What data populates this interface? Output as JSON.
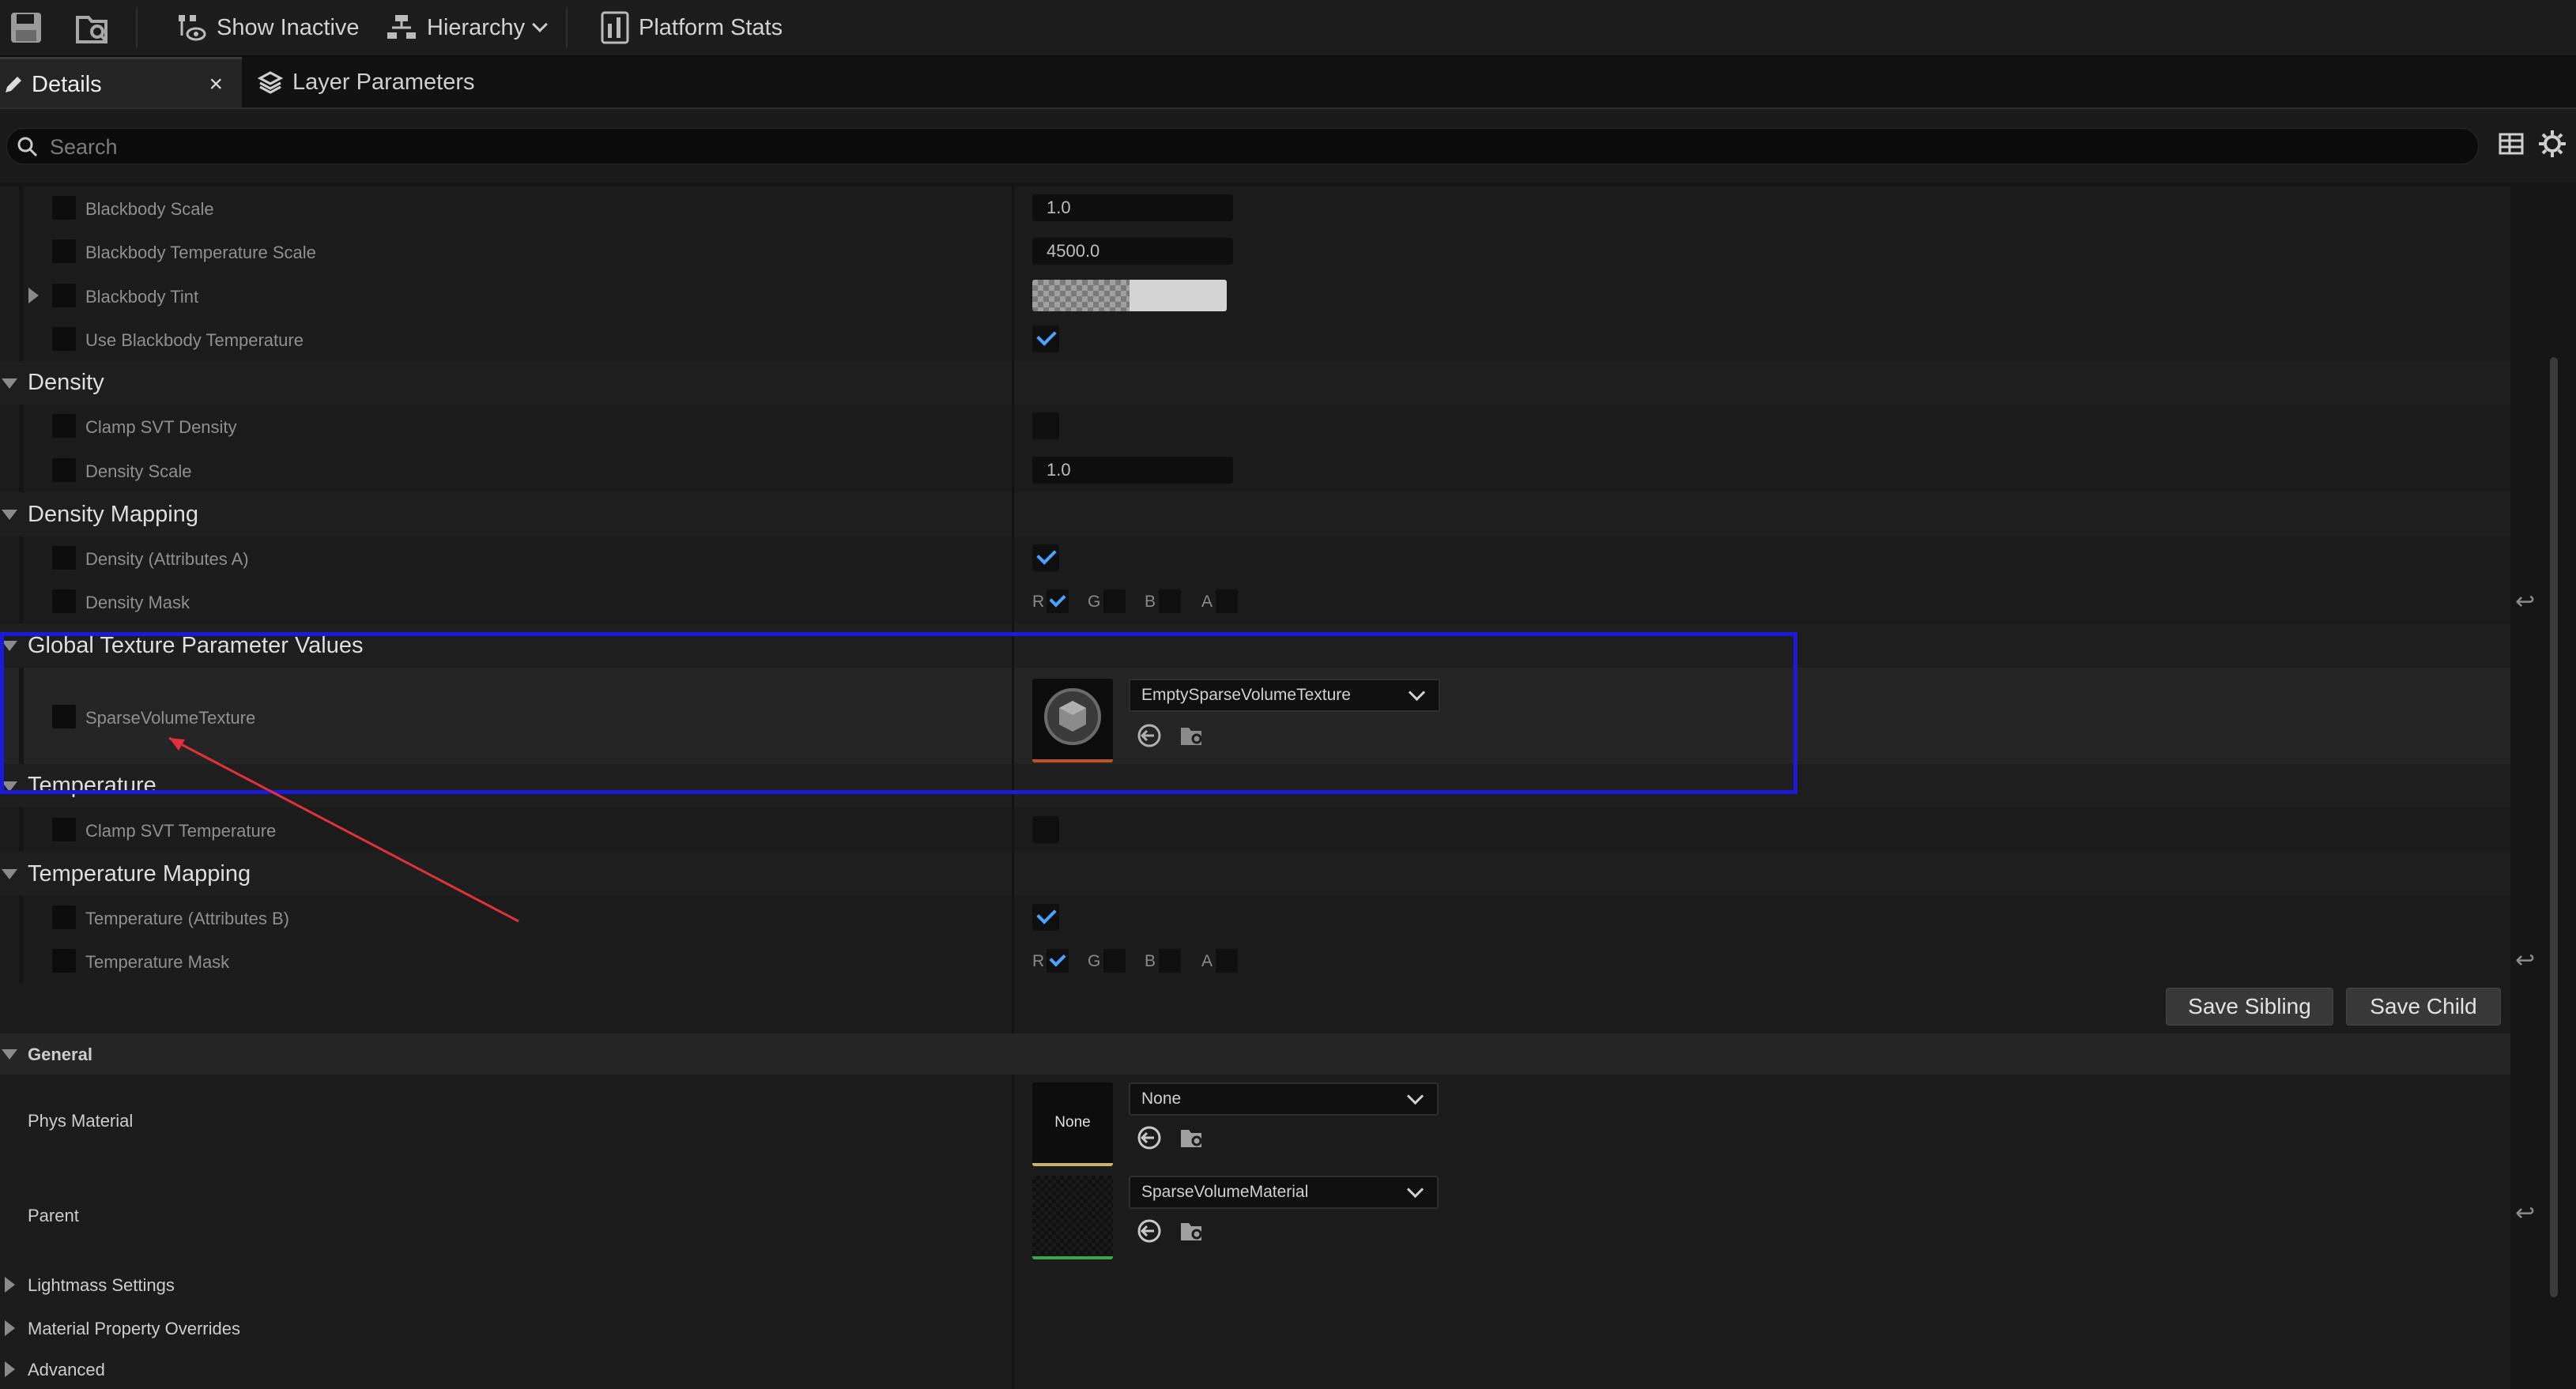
{
  "toolbar": {
    "save_icon": "save-icon",
    "browse_icon": "browse-icon",
    "show_inactive": "Show Inactive",
    "hierarchy": "Hierarchy",
    "platform_stats": "Platform Stats"
  },
  "tabs": {
    "details": "Details",
    "details_close": "×",
    "layer_parameters": "Layer Parameters"
  },
  "search": {
    "placeholder": "Search"
  },
  "blackbody": {
    "scale_label": "Blackbody Scale",
    "scale_value": "1.0",
    "temp_scale_label": "Blackbody Temperature Scale",
    "temp_scale_value": "4500.0",
    "tint_label": "Blackbody Tint",
    "use_temp_label": "Use Blackbody Temperature",
    "use_temp_checked": true
  },
  "density": {
    "title": "Density",
    "clamp_label": "Clamp SVT Density",
    "clamp_checked": false,
    "scale_label": "Density Scale",
    "scale_value": "1.0"
  },
  "density_mapping": {
    "title": "Density Mapping",
    "attr_label": "Density (Attributes A)",
    "attr_checked": true,
    "mask_label": "Density Mask",
    "channels": [
      "R",
      "G",
      "B",
      "A"
    ]
  },
  "global_texture": {
    "title": "Global Texture Parameter Values",
    "svt_label": "SparseVolumeTexture",
    "svt_value": "EmptySparseVolumeTexture"
  },
  "temperature": {
    "title": "Temperature",
    "clamp_label": "Clamp SVT Temperature",
    "clamp_checked": false
  },
  "temperature_mapping": {
    "title": "Temperature Mapping",
    "attr_label": "Temperature (Attributes B)",
    "attr_checked": true,
    "mask_label": "Temperature Mask",
    "channels": [
      "R",
      "G",
      "B",
      "A"
    ]
  },
  "actions": {
    "save_sibling": "Save Sibling",
    "save_child": "Save Child"
  },
  "general": {
    "title": "General",
    "phys_label": "Phys Material",
    "phys_thumb": "None",
    "phys_value": "None",
    "parent_label": "Parent",
    "parent_value": "SparseVolumeMaterial"
  },
  "collapsed": {
    "lightmass": "Lightmass Settings",
    "overrides": "Material Property Overrides",
    "advanced": "Advanced"
  },
  "colors": {
    "highlight_box": "#1a1ad8",
    "annotation_arrow": "#e0303a",
    "check": "#4aa3ff"
  }
}
